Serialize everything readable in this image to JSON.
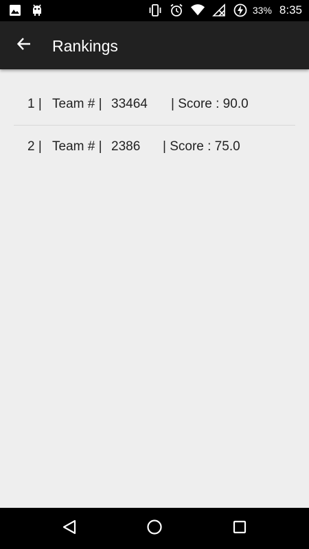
{
  "status_bar": {
    "battery_percent": "33%",
    "time": "8:35",
    "icons": [
      "image-icon",
      "android-debug-icon",
      "vibrate-icon",
      "alarm-icon",
      "wifi-icon",
      "no-signal-icon",
      "battery-charging-icon"
    ]
  },
  "app_bar": {
    "title": "Rankings",
    "back_icon": "arrow-back-icon"
  },
  "rankings": [
    {
      "rank": "1 |",
      "team_label": "Team # |",
      "team_number": "33464",
      "score": "| Score : 90.0"
    },
    {
      "rank": "2 |",
      "team_label": "Team # |",
      "team_number": "2386",
      "score": "| Score : 75.0"
    }
  ],
  "nav_bar": {
    "icons": [
      "back-triangle-icon",
      "home-circle-icon",
      "recents-square-icon"
    ]
  },
  "colors": {
    "status_bar": "#000000",
    "app_bar": "#212121",
    "background": "#eeeeee",
    "text": "#222222",
    "divider": "#d8d8d8"
  }
}
